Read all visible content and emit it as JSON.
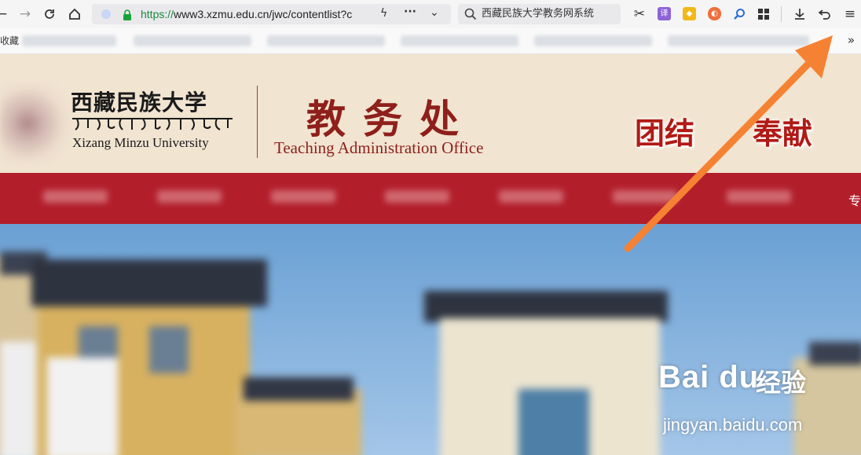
{
  "browser": {
    "url_protocol": "https://",
    "url_host_path": "www3.xzmu.edu.cn/jwc/contentlist?c",
    "search_text": "西藏民族大学教务网系统",
    "translate_ext": "译"
  },
  "bookmarks": {
    "label": "收藏",
    "more": "»"
  },
  "header": {
    "university_cn": "西藏民族大学",
    "university_en": "Xizang Minzu University",
    "office_cn": "教务处",
    "office_en": "Teaching Administration Office",
    "motto_1": "团结",
    "motto_2": "奉献"
  },
  "nav": {
    "edge_char": "专"
  },
  "watermark": {
    "brand": "Bai du",
    "brand_cn": "经验",
    "site": "jingyan.baidu.com"
  },
  "annotation_color": "#f58233",
  "colors": {
    "header_bg": "#f1e4d1",
    "nav_bg": "#b21f2b",
    "office_text": "#8e1f1a"
  }
}
